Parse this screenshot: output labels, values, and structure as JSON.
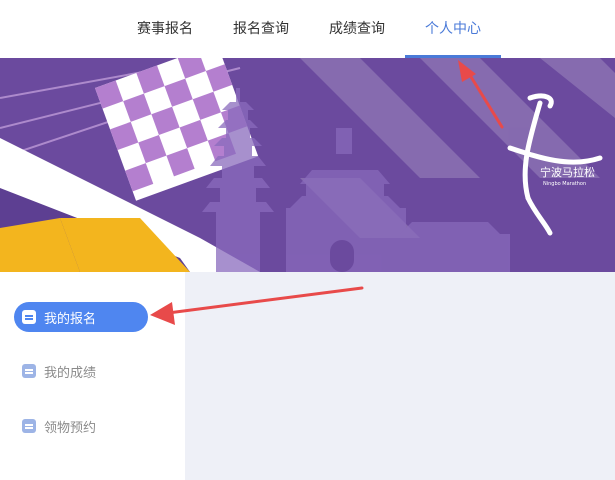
{
  "topnav": {
    "items": [
      {
        "label": "赛事报名"
      },
      {
        "label": "报名查询"
      },
      {
        "label": "成绩查询"
      },
      {
        "label": "个人中心"
      }
    ]
  },
  "banner": {
    "logo_cn": "宁波马拉松",
    "logo_en": "Ningbo Marathon"
  },
  "sidebar": {
    "items": [
      {
        "label": "我的报名"
      },
      {
        "label": "我的成绩"
      },
      {
        "label": "领物预约"
      }
    ]
  },
  "colors": {
    "accent": "#4a7ad8",
    "active_menu": "#4f86f0",
    "banner_purple": "#6b4a9e",
    "annotation_arrow": "#e84a4a"
  }
}
